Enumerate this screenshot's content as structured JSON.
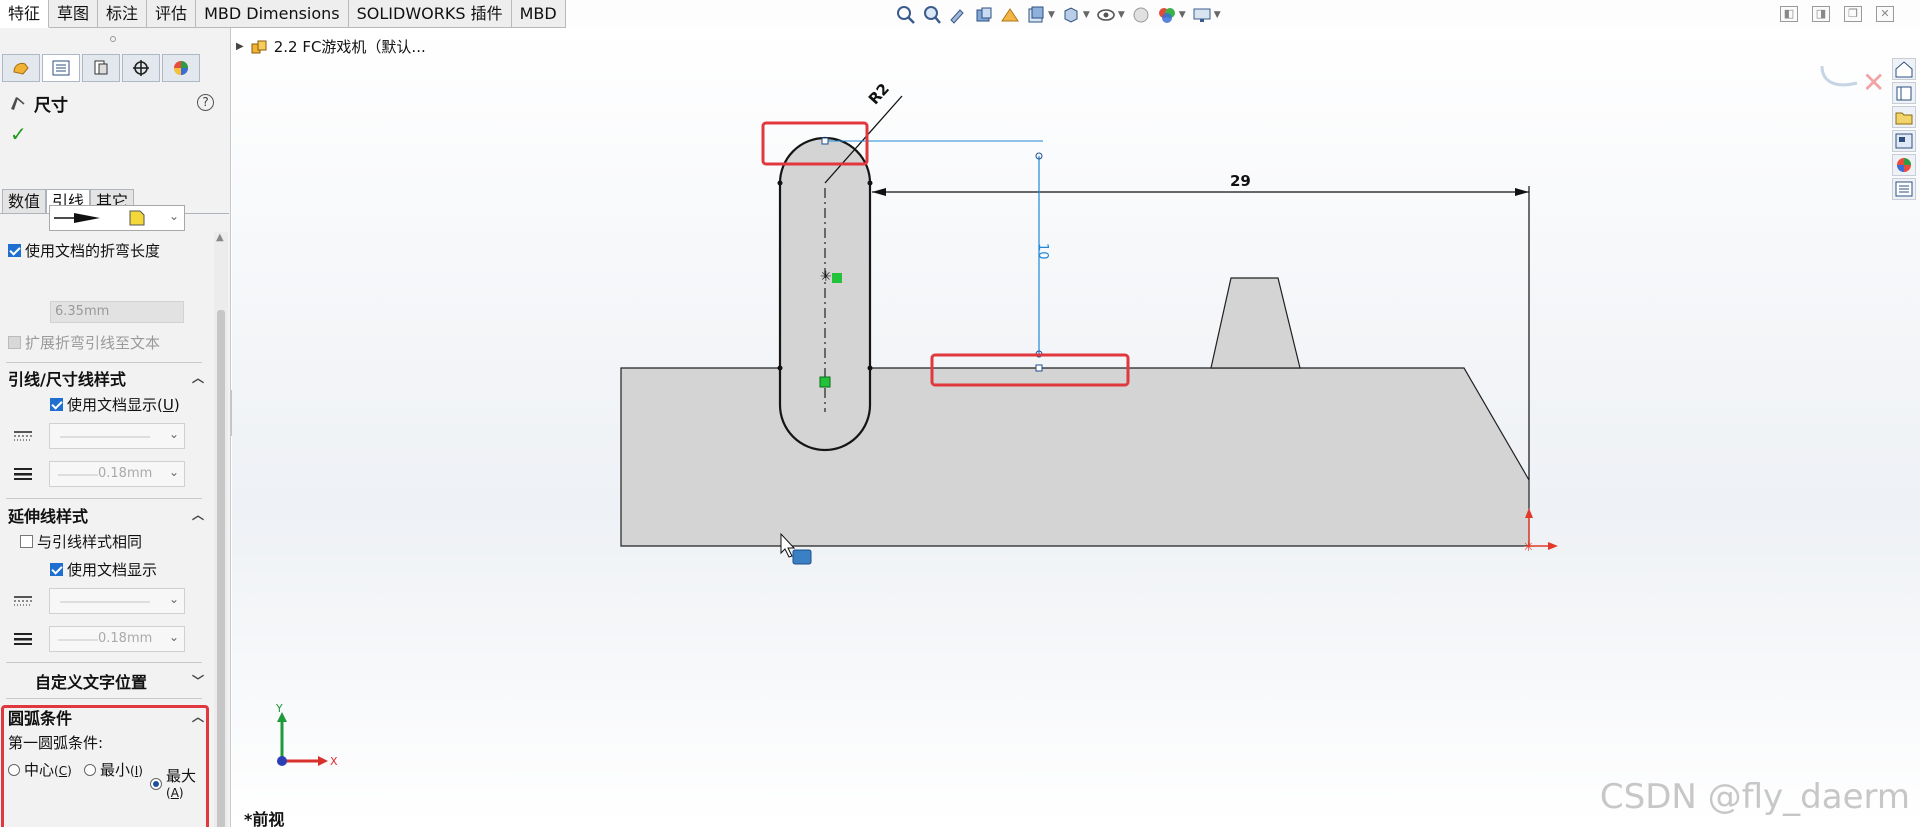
{
  "toolbar": {
    "tabs": [
      "特征",
      "草图",
      "标注",
      "评估",
      "MBD Dimensions",
      "SOLIDWORKS 插件",
      "MBD"
    ],
    "active_tab": "特征",
    "heads_up_icons": [
      "zoom-to-fit-icon",
      "zoom-area-icon",
      "previous-view-icon",
      "section-view-icon",
      "dynamic-annotation-icon",
      "view-orientation-icon",
      "display-style-icon",
      "hide-show-icon",
      "edit-appearance-icon",
      "apply-scene-icon",
      "view-settings-icon"
    ]
  },
  "property_manager": {
    "manager_tabs": [
      "feature-manager-icon",
      "property-manager-icon",
      "configuration-manager-icon",
      "dimxpert-icon",
      "display-manager-icon"
    ],
    "title": "尺寸",
    "help": "?",
    "ok_check": "✓",
    "subtabs": [
      "数值",
      "引线",
      "其它"
    ],
    "active_subtab": "引线",
    "use_doc_bend_length": "使用文档的折弯长度",
    "bend_length_value": "6.35mm",
    "extend_bend_leader": "扩展折弯引线至文本",
    "leader_style": {
      "title": "引线/尺寸线样式",
      "use_doc_display": "使用文档显示",
      "use_doc_display_key": "U",
      "thickness_value": "0.18mm"
    },
    "extension_style": {
      "title": "延伸线样式",
      "same_as_leader": "与引线样式相同",
      "use_doc_display": "使用文档显示",
      "thickness_value": "0.18mm"
    },
    "custom_text_position": "自定义文字位置",
    "arc_condition": {
      "title": "圆弧条件",
      "first_arc_label": "第一圆弧条件:",
      "options": [
        {
          "label": "中心",
          "key": "C",
          "selected": false
        },
        {
          "label": "最小",
          "key": "I",
          "selected": false
        },
        {
          "label": "最大",
          "key": "A",
          "selected": true
        }
      ]
    }
  },
  "graphics": {
    "tree_root": "2.2 FC游戏机（默认...",
    "view_label": "*前视",
    "watermark": "CSDN @fly_daerm",
    "dimensions": {
      "radius": "R2",
      "horizontal": "29",
      "vertical": "10"
    },
    "axis_labels": {
      "y": "Y",
      "x": "X"
    },
    "highlight_color": "#e0383e",
    "dimension_color": "#1e88d8",
    "part_fill": "#d4d4d4"
  }
}
